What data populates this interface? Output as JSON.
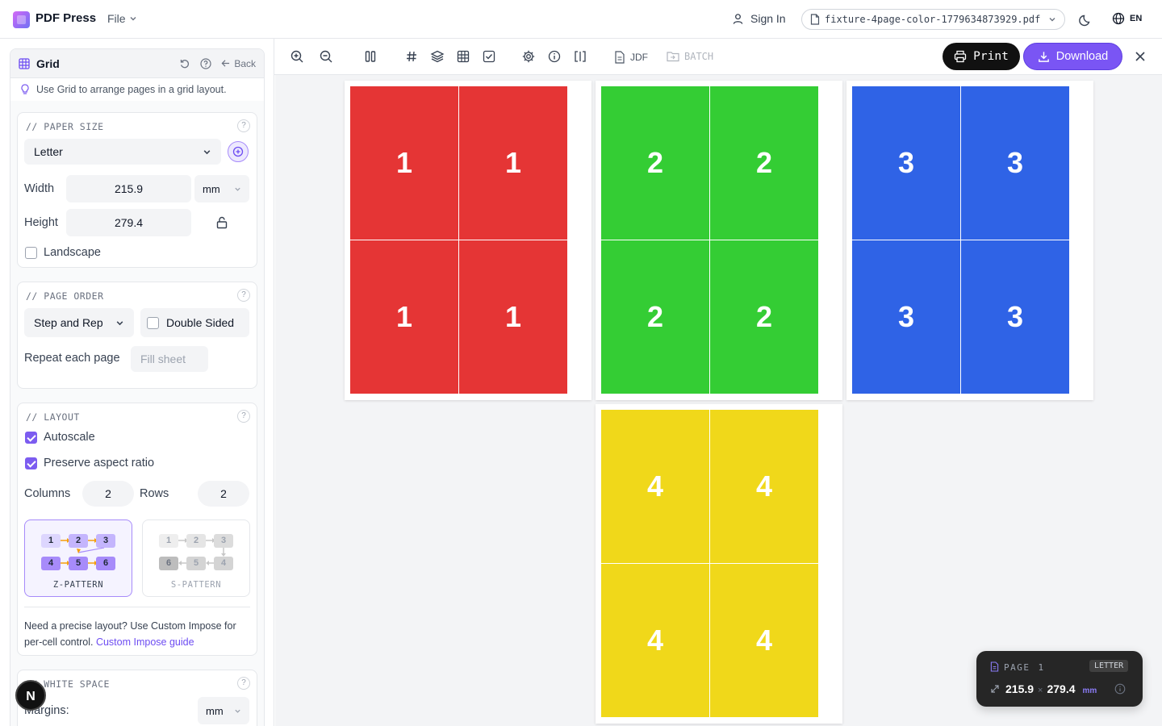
{
  "header": {
    "app_name": "PDF Press",
    "file_menu": "File",
    "sign_in": "Sign In",
    "file_name": "fixture-4page-color-1779634873929.pdf",
    "language": "EN"
  },
  "sidebar": {
    "title": "Grid",
    "back_label": "Back",
    "hint": "Use Grid to arrange pages in a grid layout.",
    "paper_size": {
      "section_title": "// PAPER SIZE",
      "size_value": "Letter",
      "width_label": "Width",
      "width_value": "215.9",
      "unit": "mm",
      "height_label": "Height",
      "height_value": "279.4",
      "landscape_label": "Landscape",
      "landscape_checked": false
    },
    "page_order": {
      "section_title": "// PAGE ORDER",
      "order_value": "Step and Rep",
      "double_sided_label": "Double Sided",
      "repeat_label": "Repeat each page",
      "repeat_placeholder": "Fill sheet"
    },
    "layout": {
      "section_title": "// LAYOUT",
      "autoscale_label": "Autoscale",
      "autoscale_checked": true,
      "aspect_label": "Preserve aspect ratio",
      "aspect_checked": true,
      "columns_label": "Columns",
      "columns_value": "2",
      "rows_label": "Rows",
      "rows_value": "2",
      "z_pattern_label": "Z-PATTERN",
      "s_pattern_label": "S-PATTERN",
      "z_cells": [
        "1",
        "2",
        "3",
        "4",
        "5",
        "6"
      ],
      "s_cells": [
        "1",
        "2",
        "3",
        "6",
        "5",
        "4"
      ],
      "precise_text": "Need a precise layout? Use Custom Impose for per-cell control.",
      "guide_link": "Custom Impose guide"
    },
    "white_space": {
      "section_title": "// WHITE SPACE",
      "margins_label": "Margins:",
      "margins_unit": "mm"
    }
  },
  "toolbar": {
    "jdf_label": "JDF",
    "batch_label": "BATCH",
    "print_label": "Print",
    "download_label": "Download"
  },
  "canvas": {
    "sheets": [
      {
        "page": "1",
        "color": "#e53535"
      },
      {
        "page": "2",
        "color": "#34cd34"
      },
      {
        "page": "3",
        "color": "#2f63e6"
      },
      {
        "page": "4",
        "color": "#f0d81a"
      }
    ]
  },
  "info_panel": {
    "page_label": "PAGE",
    "page_number": "1",
    "size_badge": "LETTER",
    "width": "215.9",
    "times": "×",
    "height": "279.4",
    "unit": "mm"
  },
  "badge_letter": "N"
}
